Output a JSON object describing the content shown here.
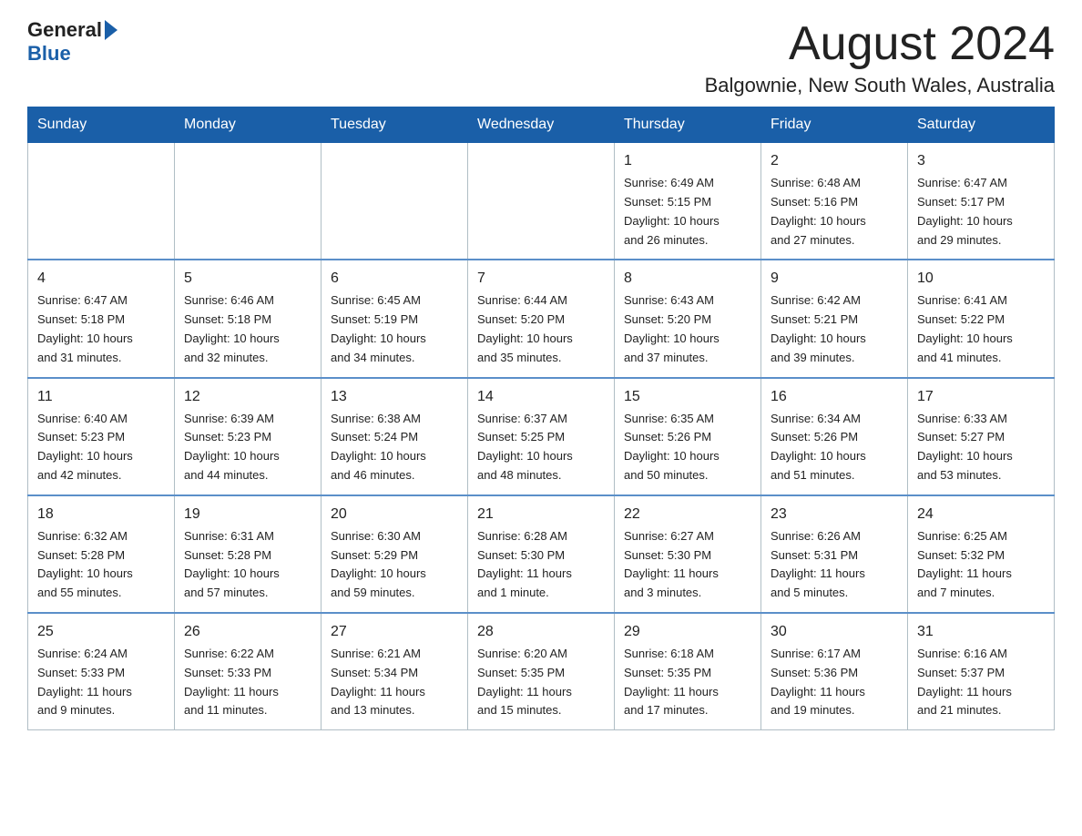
{
  "header": {
    "logo_general": "General",
    "logo_blue": "Blue",
    "month_title": "August 2024",
    "location": "Balgownie, New South Wales, Australia"
  },
  "weekdays": [
    "Sunday",
    "Monday",
    "Tuesday",
    "Wednesday",
    "Thursday",
    "Friday",
    "Saturday"
  ],
  "weeks": [
    {
      "days": [
        {
          "num": "",
          "info": ""
        },
        {
          "num": "",
          "info": ""
        },
        {
          "num": "",
          "info": ""
        },
        {
          "num": "",
          "info": ""
        },
        {
          "num": "1",
          "info": "Sunrise: 6:49 AM\nSunset: 5:15 PM\nDaylight: 10 hours\nand 26 minutes."
        },
        {
          "num": "2",
          "info": "Sunrise: 6:48 AM\nSunset: 5:16 PM\nDaylight: 10 hours\nand 27 minutes."
        },
        {
          "num": "3",
          "info": "Sunrise: 6:47 AM\nSunset: 5:17 PM\nDaylight: 10 hours\nand 29 minutes."
        }
      ]
    },
    {
      "days": [
        {
          "num": "4",
          "info": "Sunrise: 6:47 AM\nSunset: 5:18 PM\nDaylight: 10 hours\nand 31 minutes."
        },
        {
          "num": "5",
          "info": "Sunrise: 6:46 AM\nSunset: 5:18 PM\nDaylight: 10 hours\nand 32 minutes."
        },
        {
          "num": "6",
          "info": "Sunrise: 6:45 AM\nSunset: 5:19 PM\nDaylight: 10 hours\nand 34 minutes."
        },
        {
          "num": "7",
          "info": "Sunrise: 6:44 AM\nSunset: 5:20 PM\nDaylight: 10 hours\nand 35 minutes."
        },
        {
          "num": "8",
          "info": "Sunrise: 6:43 AM\nSunset: 5:20 PM\nDaylight: 10 hours\nand 37 minutes."
        },
        {
          "num": "9",
          "info": "Sunrise: 6:42 AM\nSunset: 5:21 PM\nDaylight: 10 hours\nand 39 minutes."
        },
        {
          "num": "10",
          "info": "Sunrise: 6:41 AM\nSunset: 5:22 PM\nDaylight: 10 hours\nand 41 minutes."
        }
      ]
    },
    {
      "days": [
        {
          "num": "11",
          "info": "Sunrise: 6:40 AM\nSunset: 5:23 PM\nDaylight: 10 hours\nand 42 minutes."
        },
        {
          "num": "12",
          "info": "Sunrise: 6:39 AM\nSunset: 5:23 PM\nDaylight: 10 hours\nand 44 minutes."
        },
        {
          "num": "13",
          "info": "Sunrise: 6:38 AM\nSunset: 5:24 PM\nDaylight: 10 hours\nand 46 minutes."
        },
        {
          "num": "14",
          "info": "Sunrise: 6:37 AM\nSunset: 5:25 PM\nDaylight: 10 hours\nand 48 minutes."
        },
        {
          "num": "15",
          "info": "Sunrise: 6:35 AM\nSunset: 5:26 PM\nDaylight: 10 hours\nand 50 minutes."
        },
        {
          "num": "16",
          "info": "Sunrise: 6:34 AM\nSunset: 5:26 PM\nDaylight: 10 hours\nand 51 minutes."
        },
        {
          "num": "17",
          "info": "Sunrise: 6:33 AM\nSunset: 5:27 PM\nDaylight: 10 hours\nand 53 minutes."
        }
      ]
    },
    {
      "days": [
        {
          "num": "18",
          "info": "Sunrise: 6:32 AM\nSunset: 5:28 PM\nDaylight: 10 hours\nand 55 minutes."
        },
        {
          "num": "19",
          "info": "Sunrise: 6:31 AM\nSunset: 5:28 PM\nDaylight: 10 hours\nand 57 minutes."
        },
        {
          "num": "20",
          "info": "Sunrise: 6:30 AM\nSunset: 5:29 PM\nDaylight: 10 hours\nand 59 minutes."
        },
        {
          "num": "21",
          "info": "Sunrise: 6:28 AM\nSunset: 5:30 PM\nDaylight: 11 hours\nand 1 minute."
        },
        {
          "num": "22",
          "info": "Sunrise: 6:27 AM\nSunset: 5:30 PM\nDaylight: 11 hours\nand 3 minutes."
        },
        {
          "num": "23",
          "info": "Sunrise: 6:26 AM\nSunset: 5:31 PM\nDaylight: 11 hours\nand 5 minutes."
        },
        {
          "num": "24",
          "info": "Sunrise: 6:25 AM\nSunset: 5:32 PM\nDaylight: 11 hours\nand 7 minutes."
        }
      ]
    },
    {
      "days": [
        {
          "num": "25",
          "info": "Sunrise: 6:24 AM\nSunset: 5:33 PM\nDaylight: 11 hours\nand 9 minutes."
        },
        {
          "num": "26",
          "info": "Sunrise: 6:22 AM\nSunset: 5:33 PM\nDaylight: 11 hours\nand 11 minutes."
        },
        {
          "num": "27",
          "info": "Sunrise: 6:21 AM\nSunset: 5:34 PM\nDaylight: 11 hours\nand 13 minutes."
        },
        {
          "num": "28",
          "info": "Sunrise: 6:20 AM\nSunset: 5:35 PM\nDaylight: 11 hours\nand 15 minutes."
        },
        {
          "num": "29",
          "info": "Sunrise: 6:18 AM\nSunset: 5:35 PM\nDaylight: 11 hours\nand 17 minutes."
        },
        {
          "num": "30",
          "info": "Sunrise: 6:17 AM\nSunset: 5:36 PM\nDaylight: 11 hours\nand 19 minutes."
        },
        {
          "num": "31",
          "info": "Sunrise: 6:16 AM\nSunset: 5:37 PM\nDaylight: 11 hours\nand 21 minutes."
        }
      ]
    }
  ]
}
